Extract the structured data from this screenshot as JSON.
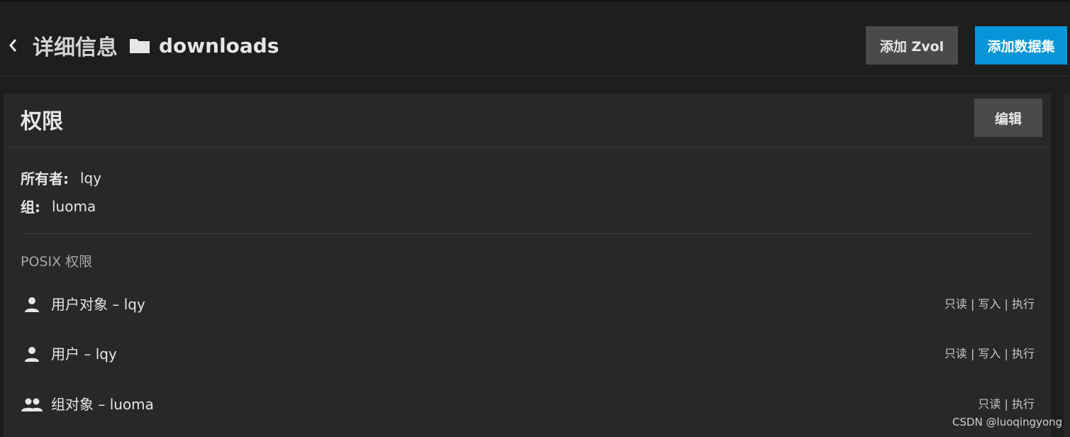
{
  "header": {
    "title": "详细信息",
    "dataset_name": "downloads",
    "add_zvol_label": "添加 Zvol",
    "add_dataset_label": "添加数据集"
  },
  "permissions": {
    "title": "权限",
    "edit_label": "编辑",
    "owner_label": "所有者:",
    "owner_value": "lqy",
    "group_label": "组:",
    "group_value": "luoma",
    "section_title": "POSIX 权限",
    "rows": [
      {
        "icon": "user-icon",
        "label": "用户对象 – lqy",
        "rights": "只读 | 写入 | 执行"
      },
      {
        "icon": "user-icon",
        "label": "用户 – lqy",
        "rights": "只读 | 写入 | 执行"
      },
      {
        "icon": "group-icon",
        "label": "组对象 – luoma",
        "rights": "只读 | 执行"
      }
    ]
  },
  "watermark": "CSDN @luoqingyong",
  "colors": {
    "background": "#1e1e1e",
    "card": "#282828",
    "primary_button": "#0895d8",
    "secondary_button": "#4a4a4a"
  }
}
